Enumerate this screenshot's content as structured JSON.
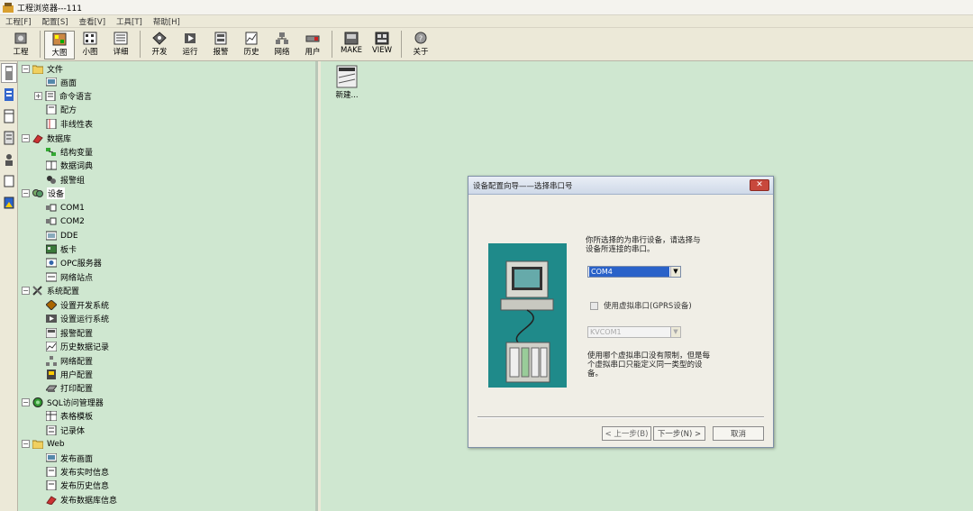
{
  "window": {
    "title": "工程浏览器---111"
  },
  "menu": [
    "工程[F]",
    "配置[S]",
    "查看[V]",
    "工具[T]",
    "帮助[H]"
  ],
  "toolbar": [
    {
      "label": "工程",
      "icon": "project-icon"
    },
    {
      "label": "大图",
      "icon": "large-icons-icon",
      "active": true
    },
    {
      "label": "小图",
      "icon": "small-icons-icon"
    },
    {
      "label": "详细",
      "icon": "details-icon"
    },
    {
      "label": "开发",
      "icon": "develop-icon"
    },
    {
      "label": "运行",
      "icon": "run-icon"
    },
    {
      "label": "报警",
      "icon": "alarm-icon"
    },
    {
      "label": "历史",
      "icon": "history-icon"
    },
    {
      "label": "网络",
      "icon": "network-icon"
    },
    {
      "label": "用户",
      "icon": "user-icon"
    },
    {
      "label": "MAKE",
      "icon": "make-icon"
    },
    {
      "label": "VIEW",
      "icon": "view-icon"
    },
    {
      "label": "关于",
      "icon": "about-icon"
    }
  ],
  "tree": {
    "file": {
      "label": "文件",
      "children": [
        "画面",
        "命令语言",
        "配方",
        "非线性表"
      ]
    },
    "database": {
      "label": "数据库",
      "children": [
        "结构变量",
        "数据词典",
        "报警组"
      ]
    },
    "device": {
      "label": "设备",
      "children": [
        "COM1",
        "COM2",
        "DDE",
        "板卡",
        "OPC服务器",
        "网络站点"
      ]
    },
    "sysconfig": {
      "label": "系统配置",
      "children": [
        "设置开发系统",
        "设置运行系统",
        "报警配置",
        "历史数据记录",
        "网络配置",
        "用户配置",
        "打印配置"
      ]
    },
    "sql": {
      "label": "SQL访问管理器",
      "children": [
        "表格模板",
        "记录体"
      ]
    },
    "web": {
      "label": "Web",
      "children": [
        "发布画面",
        "发布实时信息",
        "发布历史信息",
        "发布数据库信息"
      ]
    }
  },
  "main": {
    "new_item_label": "新建..."
  },
  "dialog": {
    "title": "设备配置向导——选择串口号",
    "close_label": "✕",
    "instruction": [
      "你所选择的为串行设备，请选择与",
      "设备所连接的串口。"
    ],
    "port_value": "COM4",
    "virtual_checkbox_label": "使用虚拟串口(GPRS设备)",
    "virtual_port_value": "KVCOM1",
    "note": [
      "使用哪个虚拟串口没有限制，但是每",
      "个虚拟串口只能定义同一类型的设",
      "备。"
    ],
    "prev_label": "< 上一步(B)",
    "next_label": "下一步(N) >",
    "cancel_label": "取消"
  },
  "colors": {
    "panel_bg": "#cfe7d0",
    "accent": "#2a62c9",
    "wizard_bg": "#1f8a8a"
  }
}
